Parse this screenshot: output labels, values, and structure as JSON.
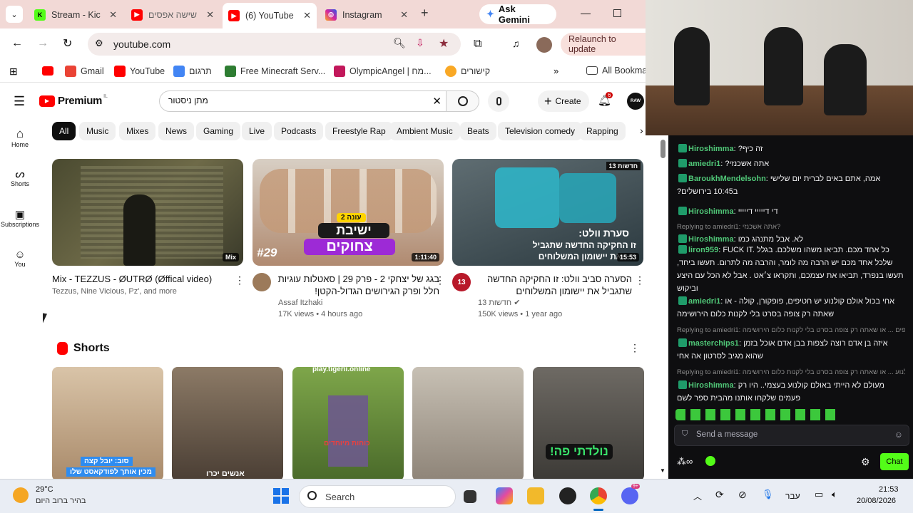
{
  "browser": {
    "tabs": [
      {
        "title": "Stream - Kic",
        "color": "#53fc18",
        "letter": "K"
      },
      {
        "title": "שישה אפסים",
        "color": "#ff0000",
        "letter": "▶"
      },
      {
        "title": "(6) YouTube",
        "color": "#ff0000",
        "letter": "▶"
      },
      {
        "title": "Instagram",
        "color": "#d6249f",
        "letter": "◎"
      }
    ],
    "gemini_label": "Ask Gemini",
    "url": "youtube.com",
    "relaunch_label": "Relaunch to update",
    "bookmarks": [
      {
        "label": "Gmail",
        "color": "#ea4335"
      },
      {
        "label": "YouTube",
        "color": "#ff0000"
      },
      {
        "label": "תרגום",
        "color": "#4285f4"
      },
      {
        "label": "Free Minecraft Serv...",
        "color": "#2e7d32"
      },
      {
        "label": "OlympicAngel | מח...",
        "color": "#c2185b"
      },
      {
        "label": "קישורים",
        "color": "#f9a825"
      }
    ],
    "all_bookmarks_label": "All Bookma"
  },
  "youtube": {
    "logo_text": "Premium",
    "logo_country": "IL",
    "search_value": "מתן ניסטור",
    "create_label": "Create",
    "notif_count": "6",
    "avatar_text": "RAW",
    "chips": [
      "All",
      "Music",
      "Mixes",
      "News",
      "Gaming",
      "Live",
      "Podcasts",
      "Freestyle Rap",
      "Ambient Music",
      "Beats",
      "Television comedy",
      "Rapping"
    ],
    "nav": [
      {
        "label": "Home",
        "icon": "home-icon"
      },
      {
        "label": "Shorts",
        "icon": "shorts-icon"
      },
      {
        "label": "Subscriptions",
        "icon": "subscriptions-icon"
      },
      {
        "label": "You",
        "icon": "you-icon"
      }
    ],
    "videos": [
      {
        "title": "Mix - TEZZUS - ØUTRØ (Øffical video)",
        "channel": "Tezzus, Nine Vicious, Pz', and more",
        "stats": "",
        "duration": "Mix",
        "thumb_color": "#5b5a3c"
      },
      {
        "title": "בגג של יצחקי 2 - פרק 29 | סאטלות עוגיות חלל ופרק הגירושים הגדול-הקטן!",
        "channel": "Assaf Itzhaki",
        "stats": "17K views • 4 hours ago",
        "duration": "1:11:40",
        "thumb_color": "#b58a6a",
        "thumb_text1": "עונה 2",
        "thumb_text2": "ישיבת",
        "thumb_text3": "צחוקים",
        "thumb_num": "#29"
      },
      {
        "title": "הסערה סביב וולט: זו החקיקה החדשה שתגביל את יישומון המשלוחים",
        "channel": "חדשות 13",
        "stats": "150K views • 1 year ago",
        "duration": "15:53",
        "thumb_color": "#3a4a50",
        "thumb_text1": "סערת וולט:",
        "thumb_text2": "זו החקיקה החדשה שתגביל",
        "thumb_text3": "את יישומון המשלוחים",
        "thumb_tag": "חדשות 13",
        "ch_icon": "13"
      }
    ],
    "shorts_title": "Shorts",
    "shorts": [
      {
        "caption": "סוב: יובל קצה",
        "caption2": "מכין אותך לפודקאסט שלו",
        "color": "#c9a27a"
      },
      {
        "caption": "אנשים יכרו",
        "caption2": "",
        "color": "#7a6a58"
      },
      {
        "caption": "play.tigerii.online",
        "caption2": "כוחות מיוחדים",
        "color": "#6b8f3a"
      },
      {
        "caption": "",
        "caption2": "",
        "color": "#a89c8c"
      },
      {
        "caption": "נולדתי פה!",
        "caption2": "",
        "color": "#5d5a55"
      }
    ]
  },
  "chat": {
    "messages": [
      {
        "type": "msg",
        "user": "Hiroshimma",
        "text": "זה כיף?"
      },
      {
        "type": "msg",
        "user": "amiedri1",
        "text": "אתה אשכנזי?"
      },
      {
        "type": "msg",
        "user": "BaroukhMendelsohn",
        "text": "אמה, אתם באים לברית יום שלישי ב10:45 בירושלים?"
      },
      {
        "type": "msg",
        "user": "Hiroshimma",
        "text": "די דייייי דייייי"
      },
      {
        "type": "reply",
        "text": "Replying to amiedri1: אתה אשכנזי?"
      },
      {
        "type": "msg",
        "user": "Hiroshimma",
        "text": "לא. אבל מתנהג כמו"
      },
      {
        "type": "msg",
        "user": "liron959",
        "text": "FUCK IT. כל אחד מכם. תביאו משהו משלכם. בגלל שלכל אחד מכם יש הרבה מה לומר, והרבה מה לתרום. תעשו ביחד, תעשו בנפרד, תביאו את עצמכם, ותקראו צ׳אט . אבל לא הכל עם היצע וביקוש"
      },
      {
        "type": "msg",
        "user": "amiedri1",
        "text": "אחי בכול אולם קולנוע יש חטיפים, פופקורן, קולה - או שאתה רק צופה בסרט בלי לקנות כלום הירושימה"
      },
      {
        "type": "reply",
        "text": "Replying to amiedri1: אחי בכול אולם קולנוע יש חטיפים ... או שאתה רק צופה בסרט בלי לקנות כלום הירושימה"
      },
      {
        "type": "msg",
        "user": "masterchips1",
        "text": "איזה בן אדם רוצה לצפות בבן אדם אוכל בזמן שהוא מגיב לסרטון אה אחי"
      },
      {
        "type": "reply",
        "text": "Replying to amiedri1: אחי בכול אולם קולנוע ... או שאתה רק צופה בסרט בלי לקנות כלום הירושימה"
      },
      {
        "type": "msg",
        "user": "Hiroshimma",
        "text": "מעולם לא הייתי באולם קולנוע בעצמי.. היו רק פעמים שלקחו אותנו מהבית ספר לשם"
      }
    ],
    "input_placeholder": "Send a message",
    "chat_button": "Chat"
  },
  "taskbar": {
    "temp": "29°C",
    "weather": "בהיר ברוב היום",
    "search_placeholder": "Search",
    "lang": "עבר",
    "time": "21:53",
    "date": "20/08/2026",
    "discord_badge": "9+"
  }
}
